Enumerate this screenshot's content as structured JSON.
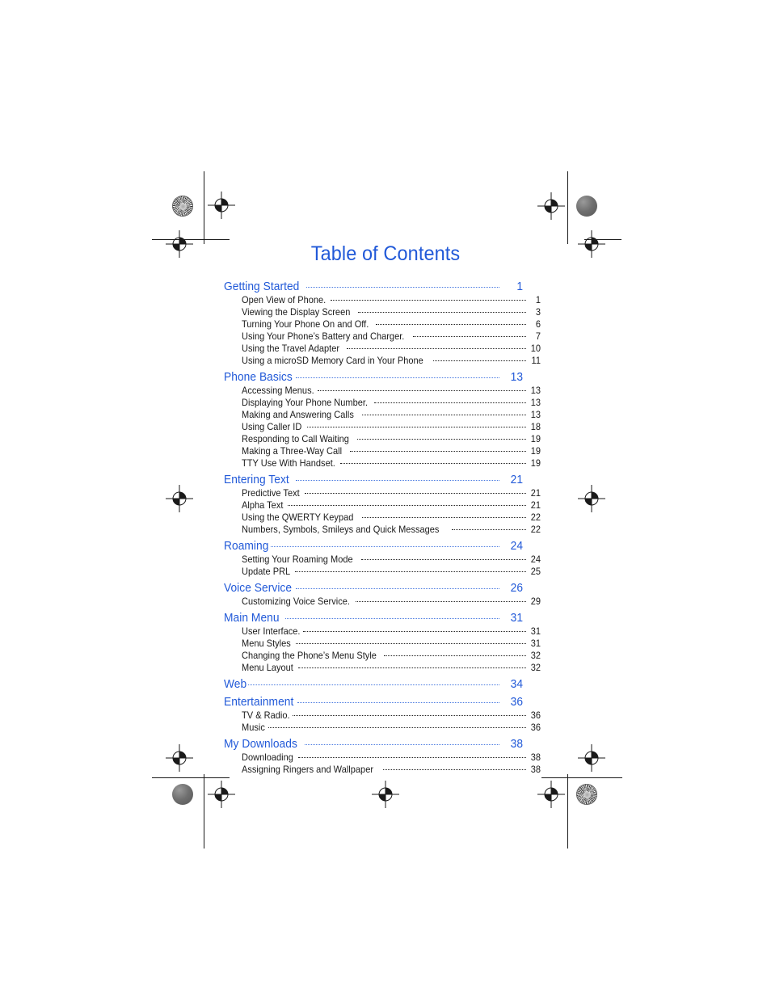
{
  "document": {
    "title": "Table of Contents",
    "title_color": "#2159d8",
    "heading_color": "#2159d8",
    "body_color": "#1a1a1a"
  },
  "printer_marks": {
    "star_target_label": "halftone-star-target",
    "solid_dot_label": "solid-density-dot",
    "registration_label": "registration-crosshair"
  },
  "toc": {
    "sections": [
      {
        "label": "Getting Started",
        "page": "1",
        "tight_leader": false,
        "entries": [
          {
            "label": "Open View of Phone.",
            "page": "1",
            "tight_leader": true
          },
          {
            "label": "Viewing the Display Screen",
            "page": "3",
            "tight_leader": false
          },
          {
            "label": "Turning Your Phone On and Off.",
            "page": "6",
            "tight_leader": true
          },
          {
            "label": "Using Your Phone’s Battery and Charger.",
            "page": "7",
            "tight_leader": true
          },
          {
            "label": "Using the Travel Adapter",
            "page": "10",
            "tight_leader": false
          },
          {
            "label": "Using a microSD Memory Card in Your Phone",
            "page": "11",
            "tight_leader": true
          }
        ]
      },
      {
        "label": "Phone Basics",
        "page": "13",
        "tight_leader": true,
        "entries": [
          {
            "label": "Accessing Menus.",
            "page": "13",
            "tight_leader": true
          },
          {
            "label": "Displaying Your Phone Number.",
            "page": "13",
            "tight_leader": true
          },
          {
            "label": "Making and Answering Calls",
            "page": "13",
            "tight_leader": false
          },
          {
            "label": "Using Caller ID",
            "page": "18",
            "tight_leader": false
          },
          {
            "label": "Responding to Call Waiting",
            "page": "19",
            "tight_leader": false
          },
          {
            "label": "Making a Three-Way Call",
            "page": "19",
            "tight_leader": false
          },
          {
            "label": "TTY Use With Handset.",
            "page": "19",
            "tight_leader": true
          }
        ]
      },
      {
        "label": "Entering Text",
        "page": "21",
        "tight_leader": false,
        "entries": [
          {
            "label": "Predictive Text",
            "page": "21",
            "tight_leader": false
          },
          {
            "label": "Alpha Text",
            "page": "21",
            "tight_leader": false
          },
          {
            "label": "Using the QWERTY Keypad",
            "page": "22",
            "tight_leader": false
          },
          {
            "label": "Numbers, Symbols, Smileys and Quick Messages",
            "page": "22",
            "tight_leader": false
          }
        ]
      },
      {
        "label": "Roaming",
        "page": "24",
        "tight_leader": true,
        "entries": [
          {
            "label": "Setting Your Roaming Mode",
            "page": "24",
            "tight_leader": false
          },
          {
            "label": "Update PRL",
            "page": "25",
            "tight_leader": false
          }
        ]
      },
      {
        "label": "Voice Service",
        "page": "26",
        "tight_leader": true,
        "entries": [
          {
            "label": "Customizing Voice Service.",
            "page": "29",
            "tight_leader": true
          }
        ]
      },
      {
        "label": "Main Menu",
        "page": "31",
        "tight_leader": false,
        "entries": [
          {
            "label": "User Interface.",
            "page": "31",
            "tight_leader": true
          },
          {
            "label": "Menu Styles",
            "page": "31",
            "tight_leader": false
          },
          {
            "label": "Changing the Phone’s Menu Style",
            "page": "32",
            "tight_leader": true
          },
          {
            "label": "Menu Layout",
            "page": "32",
            "tight_leader": false
          }
        ]
      },
      {
        "label": "Web",
        "page": "34",
        "tight_leader": true,
        "entries": []
      },
      {
        "label": "Entertainment",
        "page": "36",
        "tight_leader": true,
        "entries": [
          {
            "label": "TV & Radio.",
            "page": "36",
            "tight_leader": true
          },
          {
            "label": "Music",
            "page": "36",
            "tight_leader": false
          }
        ]
      },
      {
        "label": "My Downloads",
        "page": "38",
        "tight_leader": false,
        "entries": [
          {
            "label": "Downloading",
            "page": "38",
            "tight_leader": false
          },
          {
            "label": "Assigning Ringers and Wallpaper",
            "page": "38",
            "tight_leader": false
          }
        ]
      }
    ]
  }
}
